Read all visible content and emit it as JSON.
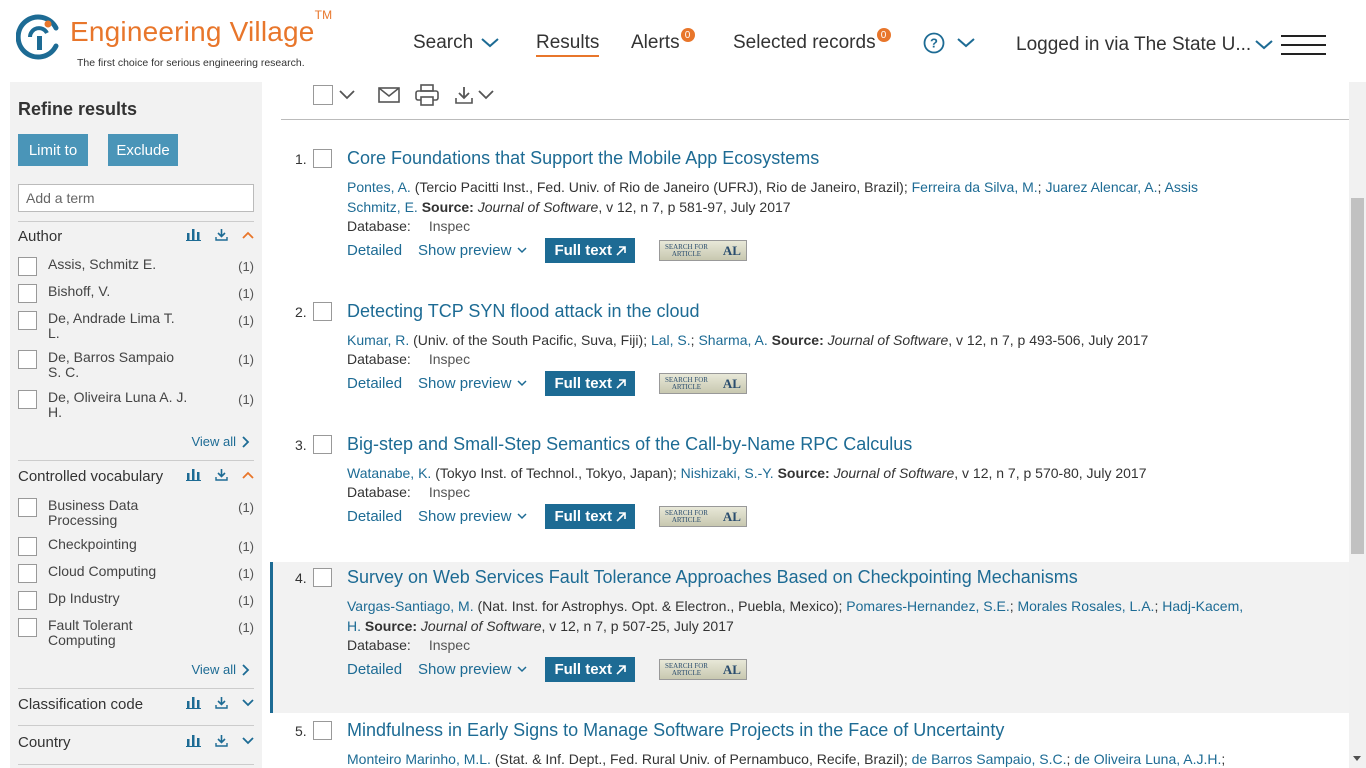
{
  "header": {
    "brand": "Engineering Village",
    "tm": "TM",
    "tagline": "The first choice for serious engineering research.",
    "nav": {
      "search": "Search",
      "results": "Results",
      "alerts": "Alerts",
      "alerts_count": "0",
      "selected": "Selected records",
      "selected_count": "0",
      "logged_in": "Logged in via The State U..."
    },
    "colors": {
      "brand": "#e8762b",
      "link": "#1d6b94"
    }
  },
  "sidebar": {
    "title": "Refine results",
    "limit_label": "Limit to",
    "exclude_label": "Exclude",
    "term_placeholder": "Add a term",
    "view_all": "View all",
    "author": {
      "label": "Author",
      "items": [
        {
          "label": "Assis, Schmitz E.",
          "count": "(1)"
        },
        {
          "label": "Bishoff, V.",
          "count": "(1)"
        },
        {
          "label": "De, Andrade Lima T. L.",
          "count": "(1)"
        },
        {
          "label": "De, Barros Sampaio S. C.",
          "count": "(1)"
        },
        {
          "label": "De, Oliveira Luna A. J. H.",
          "count": "(1)"
        }
      ]
    },
    "vocab": {
      "label": "Controlled vocabulary",
      "items": [
        {
          "label": "Business Data Processing",
          "count": "(1)"
        },
        {
          "label": "Checkpointing",
          "count": "(1)"
        },
        {
          "label": "Cloud Computing",
          "count": "(1)"
        },
        {
          "label": "Dp Industry",
          "count": "(1)"
        },
        {
          "label": "Fault Tolerant Computing",
          "count": "(1)"
        }
      ]
    },
    "classification": {
      "label": "Classification code"
    },
    "country": {
      "label": "Country"
    }
  },
  "common": {
    "source_label": "Source:",
    "database_label": "Database:",
    "database_value": "Inspec",
    "detailed": "Detailed",
    "show_preview": "Show preview",
    "full_text": "Full text",
    "afl_top": "SEARCH FOR",
    "afl_mid": "ARTICLE",
    "afl_right": "AL"
  },
  "results": [
    {
      "num": "1.",
      "title": "Core Foundations that Support the Mobile App Ecosystems",
      "a1": "Pontes, A.",
      "aff": " (Tercio Pacitti Inst., Fed. Univ. of Rio de Janeiro (UFRJ), Rio de Janeiro, Brazil); ",
      "a2": "Ferreira da Silva, M.",
      "a3": "Juarez Alencar, A.",
      "a4": "Assis Schmitz, E.",
      "journal": "Journal of Software",
      "details": ", v 12, n 7, p 581-97, July 2017"
    },
    {
      "num": "2.",
      "title": "Detecting TCP SYN flood attack in the cloud",
      "a1": "Kumar, R.",
      "aff": " (Univ. of the South Pacific, Suva, Fiji); ",
      "a2": "Lal, S.",
      "a3": "Sharma, A.",
      "journal": "Journal of Software",
      "details": ", v 12, n 7, p 493-506, July 2017"
    },
    {
      "num": "3.",
      "title": "Big-step and Small-Step Semantics of the Call-by-Name RPC Calculus",
      "a1": "Watanabe, K.",
      "aff": " (Tokyo Inst. of Technol., Tokyo, Japan); ",
      "a2": "Nishizaki, S.-Y.",
      "journal": "Journal of Software",
      "details": ", v 12, n 7, p 570-80, July 2017"
    },
    {
      "num": "4.",
      "title": "Survey on Web Services Fault Tolerance Approaches Based on Checkpointing Mechanisms",
      "a1": "Vargas-Santiago, M.",
      "aff": " (Nat. Inst. for Astrophys. Opt. & Electron., Puebla, Mexico); ",
      "a2": "Pomares-Hernandez, S.E.",
      "a3": "Morales Rosales, L.A.",
      "a4": "Hadj-Kacem, H.",
      "journal": "Journal of Software",
      "details": ", v 12, n 7, p 507-25, July 2017"
    },
    {
      "num": "5.",
      "title": "Mindfulness in Early Signs to Manage Software Projects in the Face of Uncertainty",
      "a1": "Monteiro Marinho, M.L.",
      "aff": " (Stat. & Inf. Dept., Fed. Rural Univ. of Pernambuco, Recife, Brazil); ",
      "a2": "de Barros Sampaio, S.C.",
      "a3": "de Oliveira Luna, A.J.H.",
      "sep_last": ";"
    }
  ]
}
